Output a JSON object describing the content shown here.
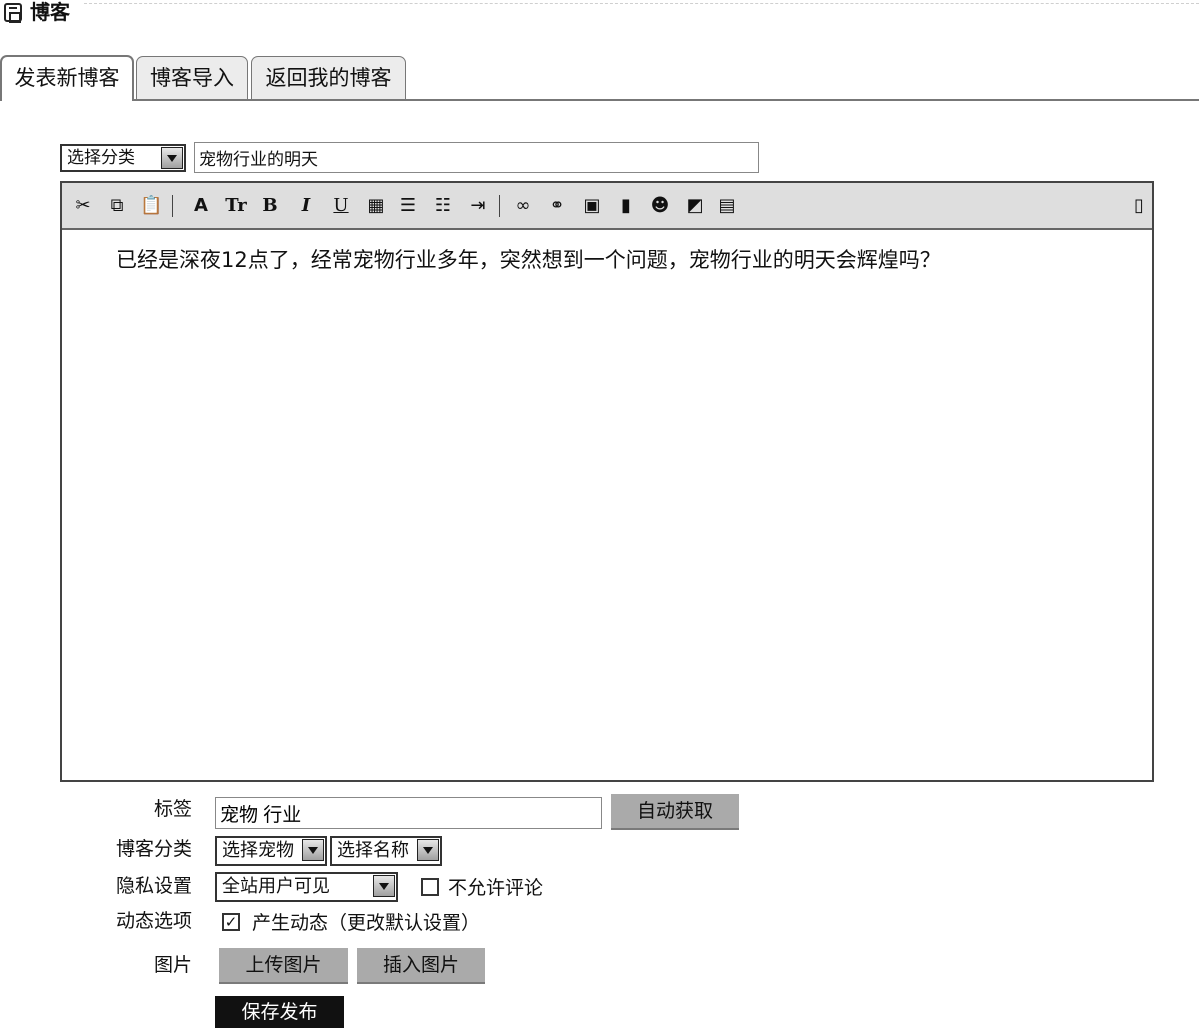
{
  "header": {
    "title": "博客",
    "icon": "blog-icon"
  },
  "tabs": [
    {
      "label": "发表新博客",
      "active": true
    },
    {
      "label": "博客导入",
      "active": false
    },
    {
      "label": "返回我的博客",
      "active": false
    }
  ],
  "compose": {
    "category_select": "选择分类",
    "title_value": "宠物行业的明天",
    "toolbar_icons": [
      "cut-icon",
      "copy-icon",
      "paste-icon",
      "font-icon",
      "font-size-icon",
      "bold-icon",
      "italic-icon",
      "underline-icon",
      "align-icon",
      "justify-icon",
      "list-icon",
      "indent-icon",
      "link-icon",
      "unlink-icon",
      "image-icon",
      "video-icon",
      "emoticon-icon",
      "flash-icon",
      "save-icon",
      "source-icon"
    ],
    "toolbar_text": {
      "fonts": "A",
      "size": "Tr",
      "bold": "B",
      "italic": "I",
      "underline": "U"
    },
    "body": "已经是深夜12点了，经常宠物行业多年，突然想到一个问题，宠物行业的明天会辉煌吗？"
  },
  "form": {
    "tags_label": "标签",
    "tags_value": "宠物 行业",
    "auto_button": "自动获取",
    "category_label": "博客分类",
    "pet_select": "选择宠物",
    "name_select": "选择名称",
    "privacy_label": "隐私设置",
    "privacy_select": "全站用户可见",
    "no_comment_label": "不允许评论",
    "no_comment_checked": false,
    "activity_label": "动态选项",
    "activity_text": "产生动态（更改默认设置）",
    "activity_checked": true,
    "image_label": "图片",
    "upload_button": "上传图片",
    "insert_button": "插入图片",
    "save_button": "保存发布"
  }
}
